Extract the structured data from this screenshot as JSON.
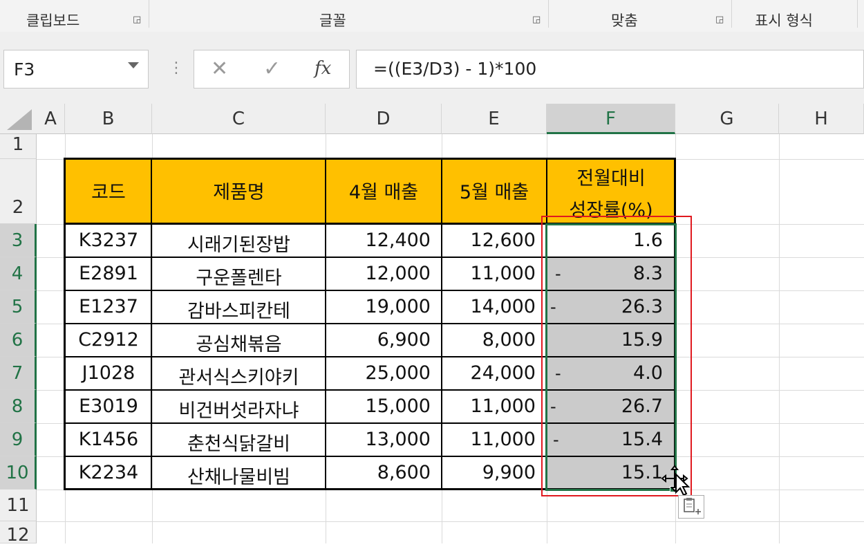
{
  "ribbon": {
    "groups": [
      "클립보드",
      "글꼴",
      "맞춤",
      "표시 형식"
    ]
  },
  "formula_bar": {
    "name_box": "F3",
    "cancel_icon": "✕",
    "enter_icon": "✓",
    "fx_label": "fx",
    "formula": "=((E3/D3) - 1)*100"
  },
  "columns": [
    "A",
    "B",
    "C",
    "D",
    "E",
    "F",
    "G",
    "H"
  ],
  "rows": [
    "1",
    "2",
    "3",
    "4",
    "5",
    "6",
    "7",
    "8",
    "9",
    "10",
    "11",
    "12"
  ],
  "table": {
    "headers": {
      "code": "코드",
      "product": "제품명",
      "april": "4월 매출",
      "may": "5월 매출",
      "growth_line1": "전월대비",
      "growth_line2": "성장률(%)"
    },
    "data": [
      {
        "code": "K3237",
        "product": "시래기된장밥",
        "april": "12,400",
        "may": "12,600",
        "sign": "",
        "growth": "1.6"
      },
      {
        "code": "E2891",
        "product": "구운폴렌타",
        "april": "12,000",
        "may": "11,000",
        "sign": "-",
        "growth": "8.3"
      },
      {
        "code": "E1237",
        "product": "감바스피칸테",
        "april": "19,000",
        "may": "14,000",
        "sign": "-",
        "growth": "26.3"
      },
      {
        "code": "C2912",
        "product": "공심채볶음",
        "april": "6,900",
        "may": "8,000",
        "sign": "",
        "growth": "15.9"
      },
      {
        "code": "J1028",
        "product": "관서식스키야키",
        "april": "25,000",
        "may": "24,000",
        "sign": "-",
        "growth": "4.0"
      },
      {
        "code": "E3019",
        "product": "비건버섯라자냐",
        "april": "15,000",
        "may": "11,000",
        "sign": "-",
        "growth": "26.7"
      },
      {
        "code": "K1456",
        "product": "춘천식닭갈비",
        "april": "13,000",
        "may": "11,000",
        "sign": "-",
        "growth": "15.4"
      },
      {
        "code": "K2234",
        "product": "산채나물비빔",
        "april": "8,600",
        "may": "9,900",
        "sign": "",
        "growth": "15.1"
      }
    ]
  },
  "colors": {
    "header_fill": "#ffc000",
    "selection_green": "#217346",
    "highlight_red": "#e0191f",
    "grey_fill": "#cbcbcb"
  }
}
